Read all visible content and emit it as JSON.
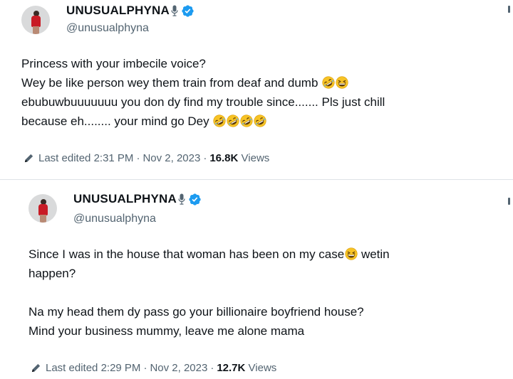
{
  "tweets": [
    {
      "display_name": "UNUSUALPHYNA",
      "handle": "@unusualphyna",
      "lines": [
        "Princess with your imbecile voice?",
        "Wey be like person wey them train from deaf and dumb",
        "ebubuwbuuuuuuu you don dy find my trouble since....... Pls just chill",
        "because eh........ your mind go Dey"
      ],
      "line_emojis": [
        [],
        [
          "rofl",
          "grin"
        ],
        [],
        [
          "rofl",
          "rofl",
          "rofl",
          "rofl"
        ]
      ],
      "edited_label": "Last edited",
      "time": "2:31 PM",
      "date": "Nov 2, 2023",
      "views_count": "16.8K",
      "views_label": "Views"
    },
    {
      "display_name": "UNUSUALPHYNA",
      "handle": "@unusualphyna",
      "lines": [
        "Since I was in the house that woman has been on my case",
        "wetin",
        "happen?",
        "Na my head them dy pass go your billionaire boyfriend house?",
        "Mind your business mummy, leave me alone mama"
      ],
      "line_emojis": [
        [
          "grin"
        ]
      ],
      "edited_label": "Last edited",
      "time": "2:29 PM",
      "date": "Nov 2, 2023",
      "views_count": "12.7K",
      "views_label": "Views"
    }
  ],
  "separator": "·",
  "icons": {
    "verified": "verified-badge-icon",
    "mic": "microphone-icon",
    "edit": "pencil-icon",
    "emoji_rofl": "rolling-on-floor-laughing-emoji",
    "emoji_grin": "grinning-squinting-face-emoji"
  },
  "colors": {
    "verified": "#1d9bf0",
    "muted": "#536471",
    "text": "#0f1419",
    "emoji": "#f7c325"
  }
}
